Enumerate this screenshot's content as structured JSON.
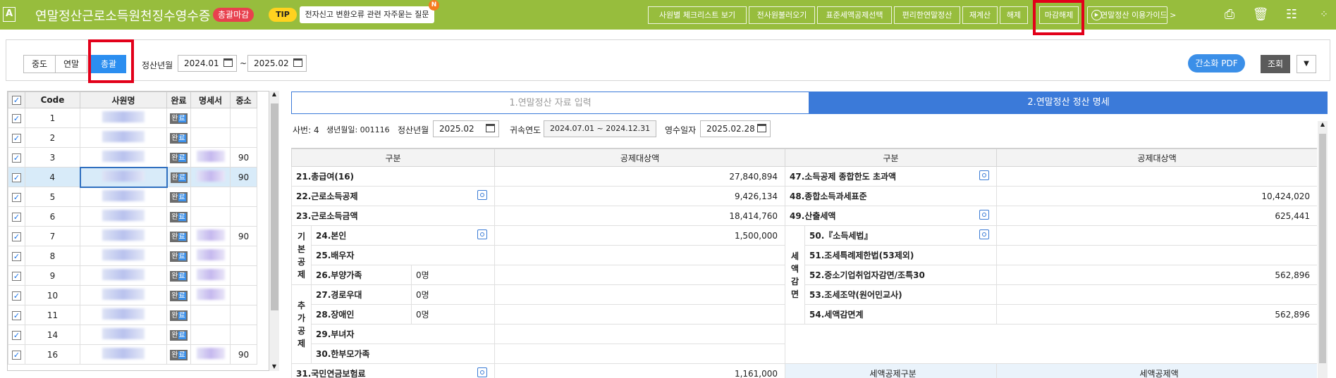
{
  "header": {
    "logo": "A",
    "title": "연말정산근로소득원천징수영수증",
    "status_badge": "총괄마감",
    "tip_label": "TIP",
    "tip_text": "전자신고 변환오류 관련 자주묻는 질문",
    "tip_new": "N",
    "buttons": [
      "사원별 체크리스트 보기",
      "전사원불러오기",
      "표준세액공제선택",
      "편리한연말정산",
      "재계산",
      "해제",
      "마감해제"
    ],
    "guide": "연말정산 이용가이드 >"
  },
  "filter": {
    "mode_tabs": [
      "중도",
      "연말",
      "총괄"
    ],
    "active_mode": "총괄",
    "period_label": "정산년월",
    "from": "2024.01",
    "to": "2025.02",
    "tilde": "~",
    "pdf_button": "간소화 PDF",
    "search_button": "조회"
  },
  "employee_grid": {
    "headers": [
      "Code",
      "사원명",
      "완료",
      "명세서",
      "중소"
    ],
    "rows": [
      {
        "code": "1",
        "done": "완료",
        "stmt": false,
        "sme": ""
      },
      {
        "code": "2",
        "done": "완료",
        "stmt": false,
        "sme": ""
      },
      {
        "code": "3",
        "done": "완료",
        "stmt": true,
        "sme": "90"
      },
      {
        "code": "4",
        "done": "완료",
        "stmt": true,
        "sme": "90"
      },
      {
        "code": "5",
        "done": "완료",
        "stmt": false,
        "sme": ""
      },
      {
        "code": "6",
        "done": "완료",
        "stmt": false,
        "sme": ""
      },
      {
        "code": "7",
        "done": "완료",
        "stmt": true,
        "sme": "90"
      },
      {
        "code": "8",
        "done": "완료",
        "stmt": true,
        "sme": ""
      },
      {
        "code": "9",
        "done": "완료",
        "stmt": true,
        "sme": ""
      },
      {
        "code": "10",
        "done": "완료",
        "stmt": true,
        "sme": ""
      },
      {
        "code": "11",
        "done": "완료",
        "stmt": false,
        "sme": ""
      },
      {
        "code": "14",
        "done": "완료",
        "stmt": false,
        "sme": ""
      },
      {
        "code": "16",
        "done": "완료",
        "stmt": true,
        "sme": "90"
      }
    ],
    "selected_code": "4"
  },
  "detail_tabs": [
    "1.연말정산 자료 입력",
    "2.연말정산 정산 명세"
  ],
  "active_detail_tab": "2.연말정산 정산 명세",
  "info": {
    "emp_no_label": "사번: 4",
    "birth_label": "생년월일: 001116",
    "settle_label": "정산년월",
    "settle_value": "2025.02",
    "year_label": "귀속연도",
    "year_value": "2024.07.01 ~ 2024.12.31",
    "receipt_label": "영수일자",
    "receipt_value": "2025.02.28"
  },
  "table": {
    "headers": [
      "구분",
      "공제대상액",
      "구분",
      "공제대상액"
    ],
    "left_rows": [
      {
        "label": "21.총급여(16)",
        "amount": "27,840,894"
      },
      {
        "label": "22.근로소득공제",
        "amount": "9,426,134"
      },
      {
        "label": "23.근로소득금액",
        "amount": "18,414,760"
      },
      {
        "label": "24.본인",
        "amount": "1,500,000"
      },
      {
        "label": "25.배우자",
        "amount": ""
      },
      {
        "label": "26.부양가족",
        "count": "0명",
        "amount": ""
      },
      {
        "label": "27.경로우대",
        "count": "0명",
        "amount": ""
      },
      {
        "label": "28.장애인",
        "count": "0명",
        "amount": ""
      },
      {
        "label": "29.부녀자",
        "amount": ""
      },
      {
        "label": "30.한부모가족",
        "amount": ""
      },
      {
        "label": "31.국민연금보험료",
        "amount": "1,161,000"
      }
    ],
    "right_rows": [
      {
        "label": "47.소득공제 종합한도 초과액",
        "amount": ""
      },
      {
        "label": "48.종합소득과세표준",
        "amount": "10,424,020"
      },
      {
        "label": "49.산출세액",
        "amount": "625,441"
      },
      {
        "label": "50.『소득세법』",
        "amount": ""
      },
      {
        "label": "51.조세특례제한법(53제외)",
        "amount": ""
      },
      {
        "label": "52.중소기업취업자감면/조특30",
        "amount": "562,896"
      },
      {
        "label": "53.조세조약(원어민교사)",
        "amount": ""
      },
      {
        "label": "54.세액감면계",
        "amount": "562,896"
      }
    ],
    "group_basic": "기\n본\n공\n제",
    "group_additional": "추\n가\n공\n제",
    "group_reduction": "세\n액\n감\n면",
    "sub_headers": [
      "세액공제구분",
      "세액공제액"
    ]
  }
}
